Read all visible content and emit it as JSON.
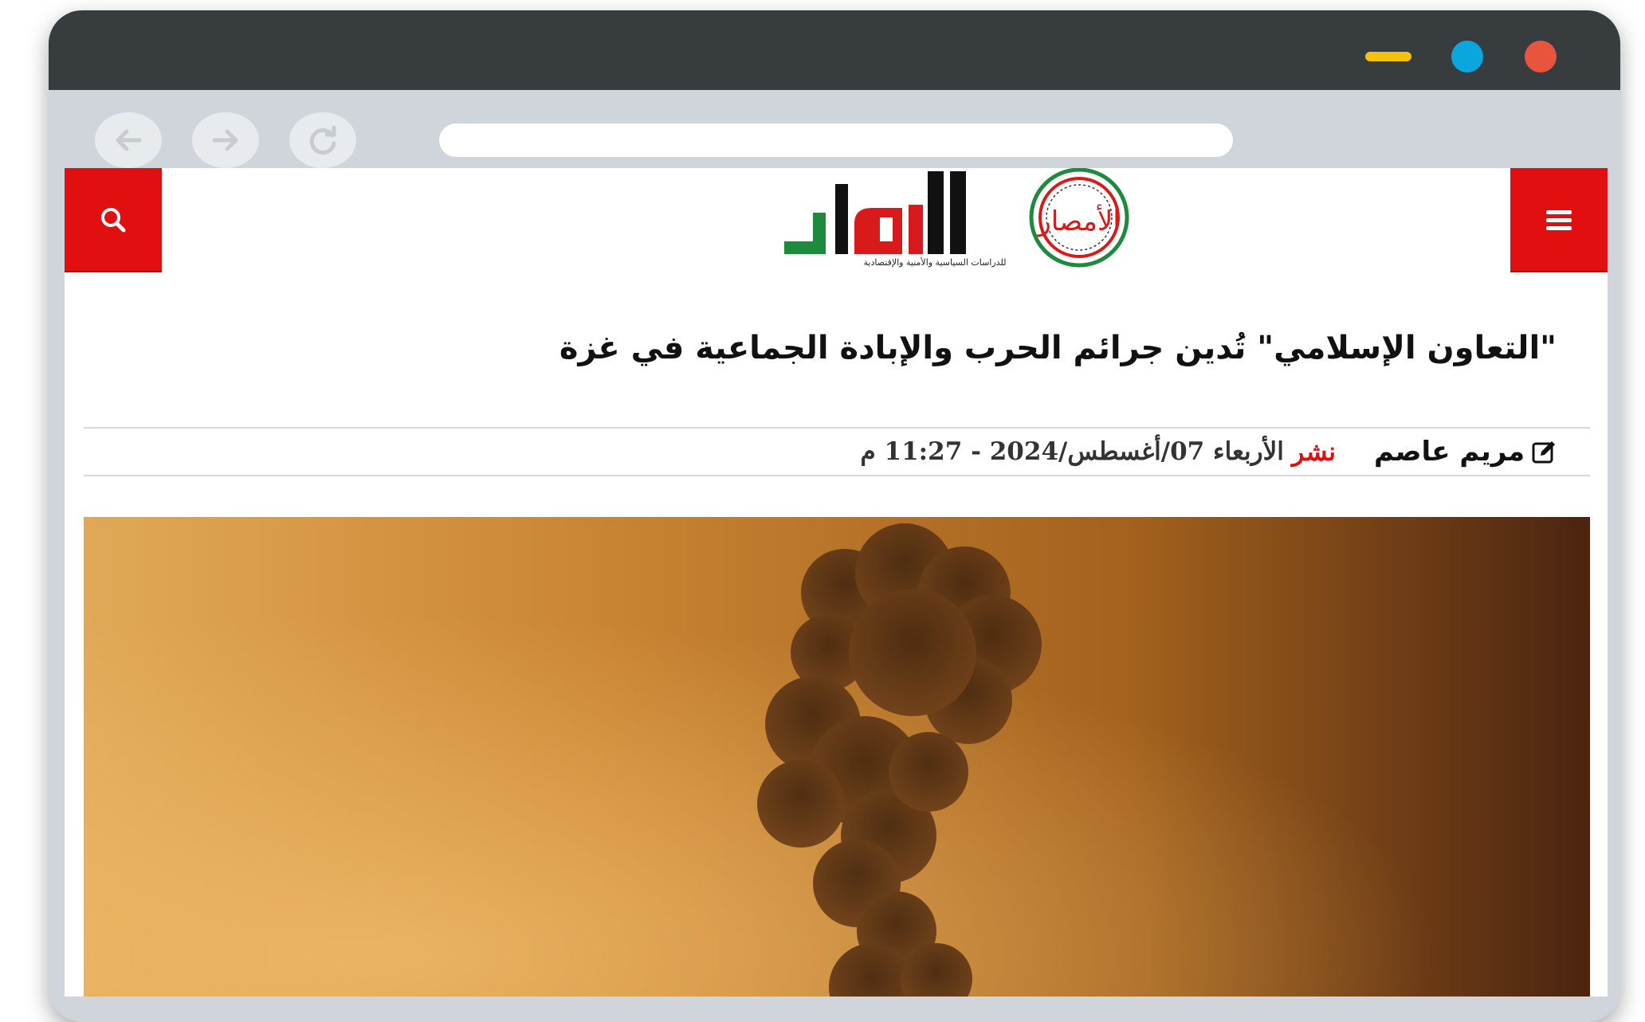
{
  "window": {
    "controls": {
      "minimize_color": "#f4c20d",
      "maximize_color": "#0ba6de",
      "close_color": "#e8553e"
    }
  },
  "browser": {
    "nav": {
      "back_icon": "arrow-left-icon",
      "forward_icon": "arrow-right-icon",
      "reload_icon": "reload-icon"
    },
    "url": ""
  },
  "site": {
    "accent_color": "#e10f10",
    "logo_text": "الأمصار",
    "logo_tagline": "للدراسات السياسية والأمنية والإقتصادية",
    "search_icon": "search-icon",
    "menu_icon": "hamburger-menu-icon"
  },
  "article": {
    "title": "\"التعاون الإسلامي\" تُدين جرائم الحرب والإبادة الجماعية في غزة",
    "author": "مريم عاصم",
    "published_label": "نشر",
    "published_date": "الأربعاء 07/أغسطس/2024 - 11:27 م",
    "image_subject": "smoke-plume-explosion-photo"
  }
}
